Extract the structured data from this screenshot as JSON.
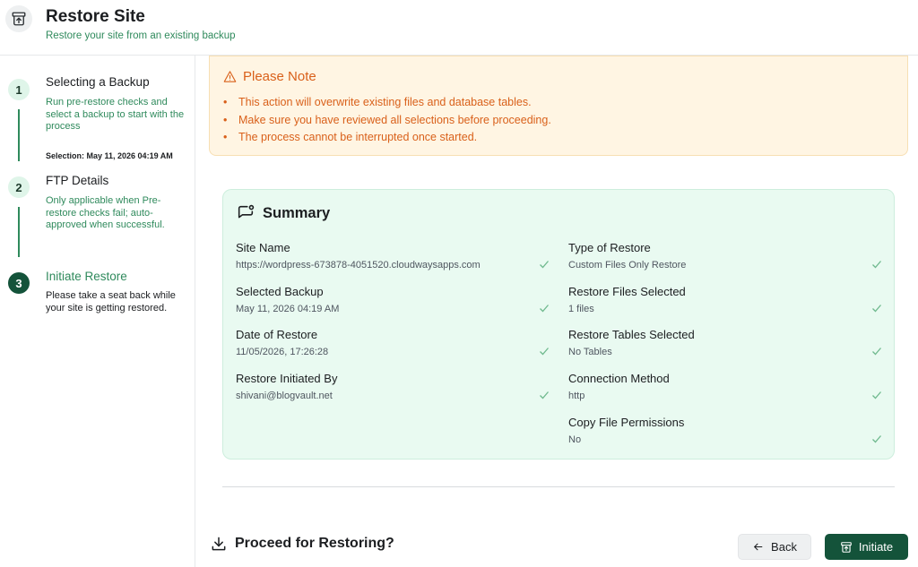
{
  "header": {
    "icon": "archive-restore-icon",
    "title": "Restore Site",
    "subtitle": "Restore your site from an existing backup"
  },
  "steps": [
    {
      "number": "1",
      "title": "Selecting a Backup",
      "description": "Run pre-restore checks and select a backup to start with the process",
      "extra": "Selection: May 11, 2026 04:19 AM",
      "state": "done"
    },
    {
      "number": "2",
      "title": "FTP Details",
      "description": "Only applicable when Pre-restore checks fail; auto-approved when successful.",
      "state": "done"
    },
    {
      "number": "3",
      "title": "Initiate Restore",
      "description": "Please take a seat back while your site is getting restored.",
      "state": "active"
    }
  ],
  "note": {
    "title": "Please Note",
    "icon": "warning-triangle-icon",
    "items": [
      "This action will overwrite existing files and database tables.",
      "Make sure you have reviewed all selections before proceeding.",
      "The process cannot be interrupted once started."
    ]
  },
  "summary": {
    "title": "Summary",
    "icon": "chat-bubble-icon",
    "left": [
      {
        "label": "Site Name",
        "value": "https://wordpress-673878-4051520.cloudwaysapps.com"
      },
      {
        "label": "Selected Backup",
        "value": "May 11, 2026 04:19 AM"
      },
      {
        "label": "Date of Restore",
        "value": "11/05/2026, 17:26:28"
      },
      {
        "label": "Restore Initiated By",
        "value": "shivani@blogvault.net"
      }
    ],
    "right": [
      {
        "label": "Type of Restore",
        "value": "Custom Files Only Restore"
      },
      {
        "label": "Restore Files Selected",
        "value": "1 files"
      },
      {
        "label": "Restore Tables Selected",
        "value": "No Tables"
      },
      {
        "label": "Connection Method",
        "value": "http"
      },
      {
        "label": "Copy File Permissions",
        "value": "No"
      }
    ]
  },
  "footer": {
    "proceed_text": "Proceed for Restoring?",
    "back_label": "Back",
    "initiate_label": "Initiate"
  },
  "colors": {
    "accent_green": "#14533a",
    "text_green": "#2f8a5c",
    "note_orange": "#d9601a",
    "note_bg": "#fff5e3",
    "summary_bg": "#e9faf1"
  }
}
